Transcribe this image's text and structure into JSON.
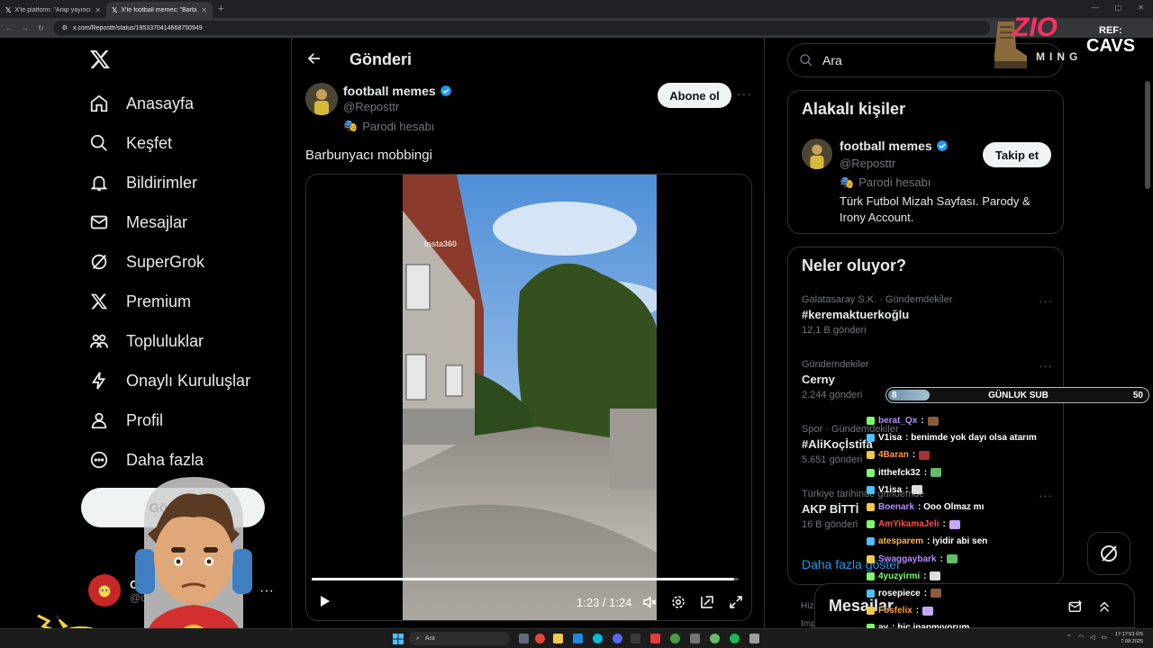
{
  "browser": {
    "tabs": [
      {
        "title": "X'te platform: \"Arap yayıncı Sat...",
        "active": false
      },
      {
        "title": "X'te football memes: \"Barbunya...",
        "active": true
      }
    ],
    "url": "x.com/Reposttr/status/1953370414668750949"
  },
  "nav": {
    "items": [
      {
        "label": "Anasayfa",
        "icon": "home-icon"
      },
      {
        "label": "Keşfet",
        "icon": "search-icon"
      },
      {
        "label": "Bildirimler",
        "icon": "bell-icon"
      },
      {
        "label": "Mesajlar",
        "icon": "mail-icon"
      },
      {
        "label": "SuperGrok",
        "icon": "grok-icon"
      },
      {
        "label": "Premium",
        "icon": "x-icon"
      },
      {
        "label": "Topluluklar",
        "icon": "people-icon"
      },
      {
        "label": "Onaylı Kuruluşlar",
        "icon": "lightning-icon"
      },
      {
        "label": "Profil",
        "icon": "person-icon"
      },
      {
        "label": "Daha fazla",
        "icon": "more-circle-icon"
      }
    ],
    "post_button": "Gönder",
    "account": {
      "name": "C",
      "handle": "@c"
    }
  },
  "main": {
    "title": "Gönderi",
    "post": {
      "author": "football memes",
      "handle": "@Reposttr",
      "parody_label": "Parodi hesabı",
      "follow_label": "Abone ol",
      "text": "Barbunyacı mobbingi",
      "video": {
        "watermark": "Insta360",
        "progress": 0.99,
        "time": "1:23 / 1:24"
      }
    }
  },
  "sidebar": {
    "search_placeholder": "Ara",
    "related": {
      "title": "Alakalı kişiler",
      "name": "football memes",
      "handle": "@Reposttr",
      "parody_label": "Parodi hesabı",
      "bio": "Türk Futbol Mizah Sayfası. Parody & Irony Account.",
      "follow_label": "Takip et"
    },
    "trends": {
      "title": "Neler oluyor?",
      "items": [
        {
          "category": "Galatasaray S.K. · Gündemdekiler",
          "name": "#keremaktuerkoğlu",
          "count": "12,1 B gönderi"
        },
        {
          "category": "Gündemdekiler",
          "name": "Cerny",
          "count": "2.244 gönderi"
        },
        {
          "category": "Spor · Gündemdekiler",
          "name": "#AliKoçİstifa",
          "count": "5.651 gönderi"
        },
        {
          "category": "Türkiye tarihinde gündemde",
          "name": "AKP BİTTİ",
          "count": "16 B gönderi"
        }
      ],
      "show_more": "Daha fazla göster"
    },
    "footer_hint_1": "Hizm",
    "footer_hint_2": "Imp"
  },
  "messages_drawer": {
    "title": "Mesajlar"
  },
  "overlay": {
    "logo_text": "ZIO",
    "logo_sub": "MING",
    "ref_label": "REF:",
    "ref_code": "CAVS",
    "sub_goal": {
      "current": "8",
      "label": "GÜNLUK SUB",
      "target": "50",
      "fraction": 0.16
    },
    "chat": [
      {
        "user": "berat_Qx",
        "msg": ":",
        "color": "#b48cff"
      },
      {
        "user": "V1isa",
        "msg": ": benimde yok dayı olsa atarım",
        "color": "#ffffff"
      },
      {
        "user": "4Baran",
        "msg": ":",
        "color": "#ff9a3c"
      },
      {
        "user": "itthefck32",
        "msg": ":",
        "color": "#ffffff"
      },
      {
        "user": "V1isa",
        "msg": ":",
        "color": "#ffffff"
      },
      {
        "user": "Boenark",
        "msg": ": Ooo Olmaz mı",
        "color": "#b48cff"
      },
      {
        "user": "AmYikamaJeli",
        "msg": ":",
        "color": "#ff4d4d"
      },
      {
        "user": "atesparem",
        "msg": ": iyidir abi sen",
        "color": "#ffb347"
      },
      {
        "user": "Swaggaybark",
        "msg": ":",
        "color": "#b48cff"
      },
      {
        "user": "4yuzyirmi",
        "msg": ":",
        "color": "#7dff6b"
      },
      {
        "user": "rosepiece",
        "msg": ":",
        "color": "#ffffff"
      },
      {
        "user": "Fosfelix",
        "msg": ":",
        "color": "#ff9a3c"
      },
      {
        "user": "ay",
        "msg": ": hiç inanmıyorum",
        "color": "#ffffff"
      }
    ]
  },
  "taskbar": {
    "search_placeholder": "Ara",
    "time": "17:17:53 ÖS",
    "date": "7.08.2025"
  },
  "colors": {
    "accent": "#1d9bf0",
    "border": "#2f3336",
    "muted": "#71767b"
  }
}
